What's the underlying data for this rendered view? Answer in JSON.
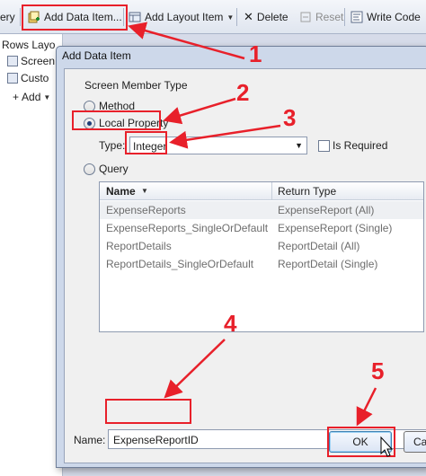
{
  "toolbar": {
    "query_fragment": "ery",
    "add_data_item": "Add Data Item...",
    "add_layout_item": "Add Layout Item",
    "delete": "Delete",
    "reset": "Reset",
    "write_code": "Write Code"
  },
  "tree": {
    "items": [
      "Rows Layo",
      "Screen",
      "Custo"
    ],
    "add_label": "Add"
  },
  "dialog": {
    "title": "Add Data Item",
    "member_type_label": "Screen Member Type",
    "method_label": "Method",
    "local_property_label": "Local Property",
    "type_label": "Type:",
    "type_value": "Integer",
    "is_required_label": "Is Required",
    "query_label": "Query",
    "selected_option": "Local Property",
    "grid": {
      "headers": [
        "Name",
        "Return Type"
      ],
      "rows": [
        [
          "ExpenseReports",
          "ExpenseReport (All)"
        ],
        [
          "ExpenseReports_SingleOrDefault",
          "ExpenseReport (Single)"
        ],
        [
          "ReportDetails",
          "ReportDetail (All)"
        ],
        [
          "ReportDetails_SingleOrDefault",
          "ReportDetail (Single)"
        ]
      ]
    },
    "name_label": "Name:",
    "name_value": "ExpenseReportID",
    "ok_label": "OK",
    "cancel_label": "Ca"
  },
  "annotations": [
    "1",
    "2",
    "3",
    "4",
    "5"
  ],
  "colors": {
    "annotation": "#e8202a",
    "dialog_frame": "#cdd8ea"
  },
  "icons": [
    "add-data-item-icon",
    "add-layout-item-icon",
    "delete-icon",
    "reset-icon",
    "write-code-icon",
    "screen-icon",
    "customer-icon",
    "dropdown-arrow-icon",
    "mouse-cursor-icon"
  ]
}
